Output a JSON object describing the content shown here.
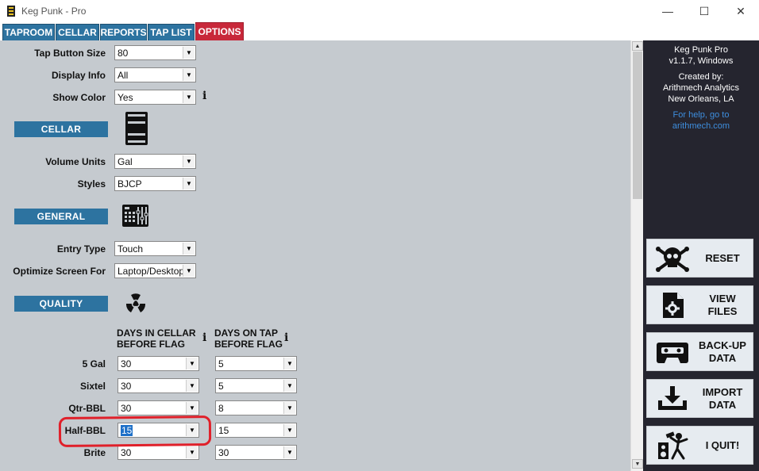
{
  "window": {
    "title": "Keg Punk - Pro",
    "minimize": "—",
    "maximize": "☐",
    "close": "✕"
  },
  "tabs": [
    {
      "label": "TAPROOM",
      "active": false
    },
    {
      "label": "CELLAR",
      "active": false
    },
    {
      "label": "REPORTS",
      "active": false
    },
    {
      "label": "TAP LIST",
      "active": false
    },
    {
      "label": "OPTIONS",
      "active": true
    }
  ],
  "taproom_options": {
    "tap_button_size": {
      "label": "Tap Button Size",
      "value": "80"
    },
    "display_info": {
      "label": "Display Info",
      "value": "All"
    },
    "show_color": {
      "label": "Show Color",
      "value": "Yes",
      "info": "i"
    }
  },
  "cellar": {
    "header": "CELLAR",
    "icon": "keg-icon",
    "volume_units": {
      "label": "Volume Units",
      "value": "Gal"
    },
    "styles": {
      "label": "Styles",
      "value": "BJCP"
    }
  },
  "general": {
    "header": "GENERAL",
    "icon": "keypad-icon",
    "entry_type": {
      "label": "Entry Type",
      "value": "Touch"
    },
    "optimize_screen": {
      "label": "Optimize Screen For",
      "value": "Laptop/Desktop"
    }
  },
  "quality": {
    "header": "QUALITY",
    "icon": "radiation-icon",
    "col_cellar": {
      "line1": "DAYS IN CELLAR",
      "line2": "BEFORE FLAG",
      "info": "i"
    },
    "col_tap": {
      "line1": "DAYS ON TAP",
      "line2": "BEFORE FLAG",
      "info": "i"
    },
    "rows": [
      {
        "label": "5 Gal",
        "cellar": "30",
        "tap": "5"
      },
      {
        "label": "Sixtel",
        "cellar": "30",
        "tap": "5"
      },
      {
        "label": "Qtr-BBL",
        "cellar": "30",
        "tap": "8"
      },
      {
        "label": "Half-BBL",
        "cellar": "15",
        "tap": "15"
      },
      {
        "label": "Brite",
        "cellar": "30",
        "tap": "30"
      }
    ]
  },
  "sidebar": {
    "app_name": "Keg Punk Pro",
    "version": "v1.1.7, Windows",
    "created_by": "Created by:",
    "company": "Arithmech Analytics",
    "location": "New Orleans, LA",
    "help_line1": "For help, go to",
    "help_line2": "arithmech.com",
    "link_color": "#3e8ede",
    "buttons": [
      {
        "icon": "skull-crossbones-icon",
        "line1": "RESET",
        "line2": ""
      },
      {
        "icon": "file-gear-icon",
        "line1": "VIEW",
        "line2": "FILES"
      },
      {
        "icon": "cassette-icon",
        "line1": "BACK-UP",
        "line2": "DATA"
      },
      {
        "icon": "download-tray-icon",
        "line1": "IMPORT",
        "line2": "DATA"
      },
      {
        "icon": "smash-speaker-icon",
        "line1": "I QUIT!",
        "line2": ""
      }
    ]
  },
  "colors": {
    "tab_blue": "#2d73a0",
    "tab_active_red": "#c8283a",
    "panel_gray": "#c5cacf",
    "sidebar_dark": "#25252f",
    "highlight_red": "#e0202a"
  }
}
